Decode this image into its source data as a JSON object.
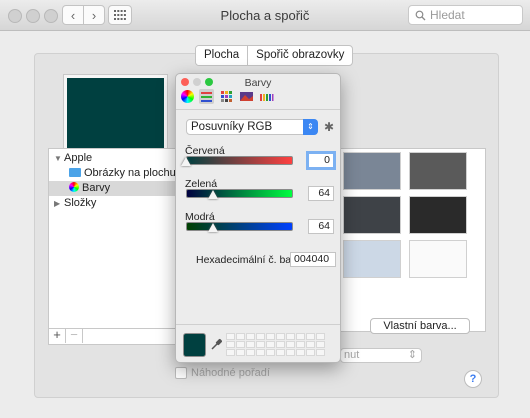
{
  "window": {
    "title": "Plocha a spořič",
    "search_placeholder": "Hledat",
    "icons": [
      "chevron-left-icon",
      "chevron-right-icon",
      "grid-icon",
      "search-icon"
    ]
  },
  "tabs": [
    {
      "label": "Plocha",
      "selected": true
    },
    {
      "label": "Spořič obrazovky",
      "selected": false
    }
  ],
  "desktop_color": "#004040",
  "sidebar": {
    "group": "Apple",
    "items": [
      "Obrázky na plochu",
      "Barvy"
    ],
    "selected_item": "Barvy",
    "folders_group": "Složky",
    "add_label": "+",
    "remove_label": "−"
  },
  "swatches": [
    "#7a8696",
    "#5a5a5a",
    "#3e4247",
    "#2a2a2a",
    "#ccd8e6",
    "#fafafa"
  ],
  "custom_color_button": "Vlastní barva...",
  "hidden_popup_value": "nut",
  "random_order_label": "Náhodné pořadí",
  "help_label": "?",
  "color_panel": {
    "title": "Barvy",
    "mode": "Posuvníky RGB",
    "red_label": "Červená",
    "red_value": "0",
    "green_label": "Zelená",
    "green_value": "64",
    "blue_label": "Modrá",
    "blue_value": "64",
    "hex_label": "Hexadecimální č. barvy",
    "hex_value": "004040",
    "current_color": "#004040"
  }
}
